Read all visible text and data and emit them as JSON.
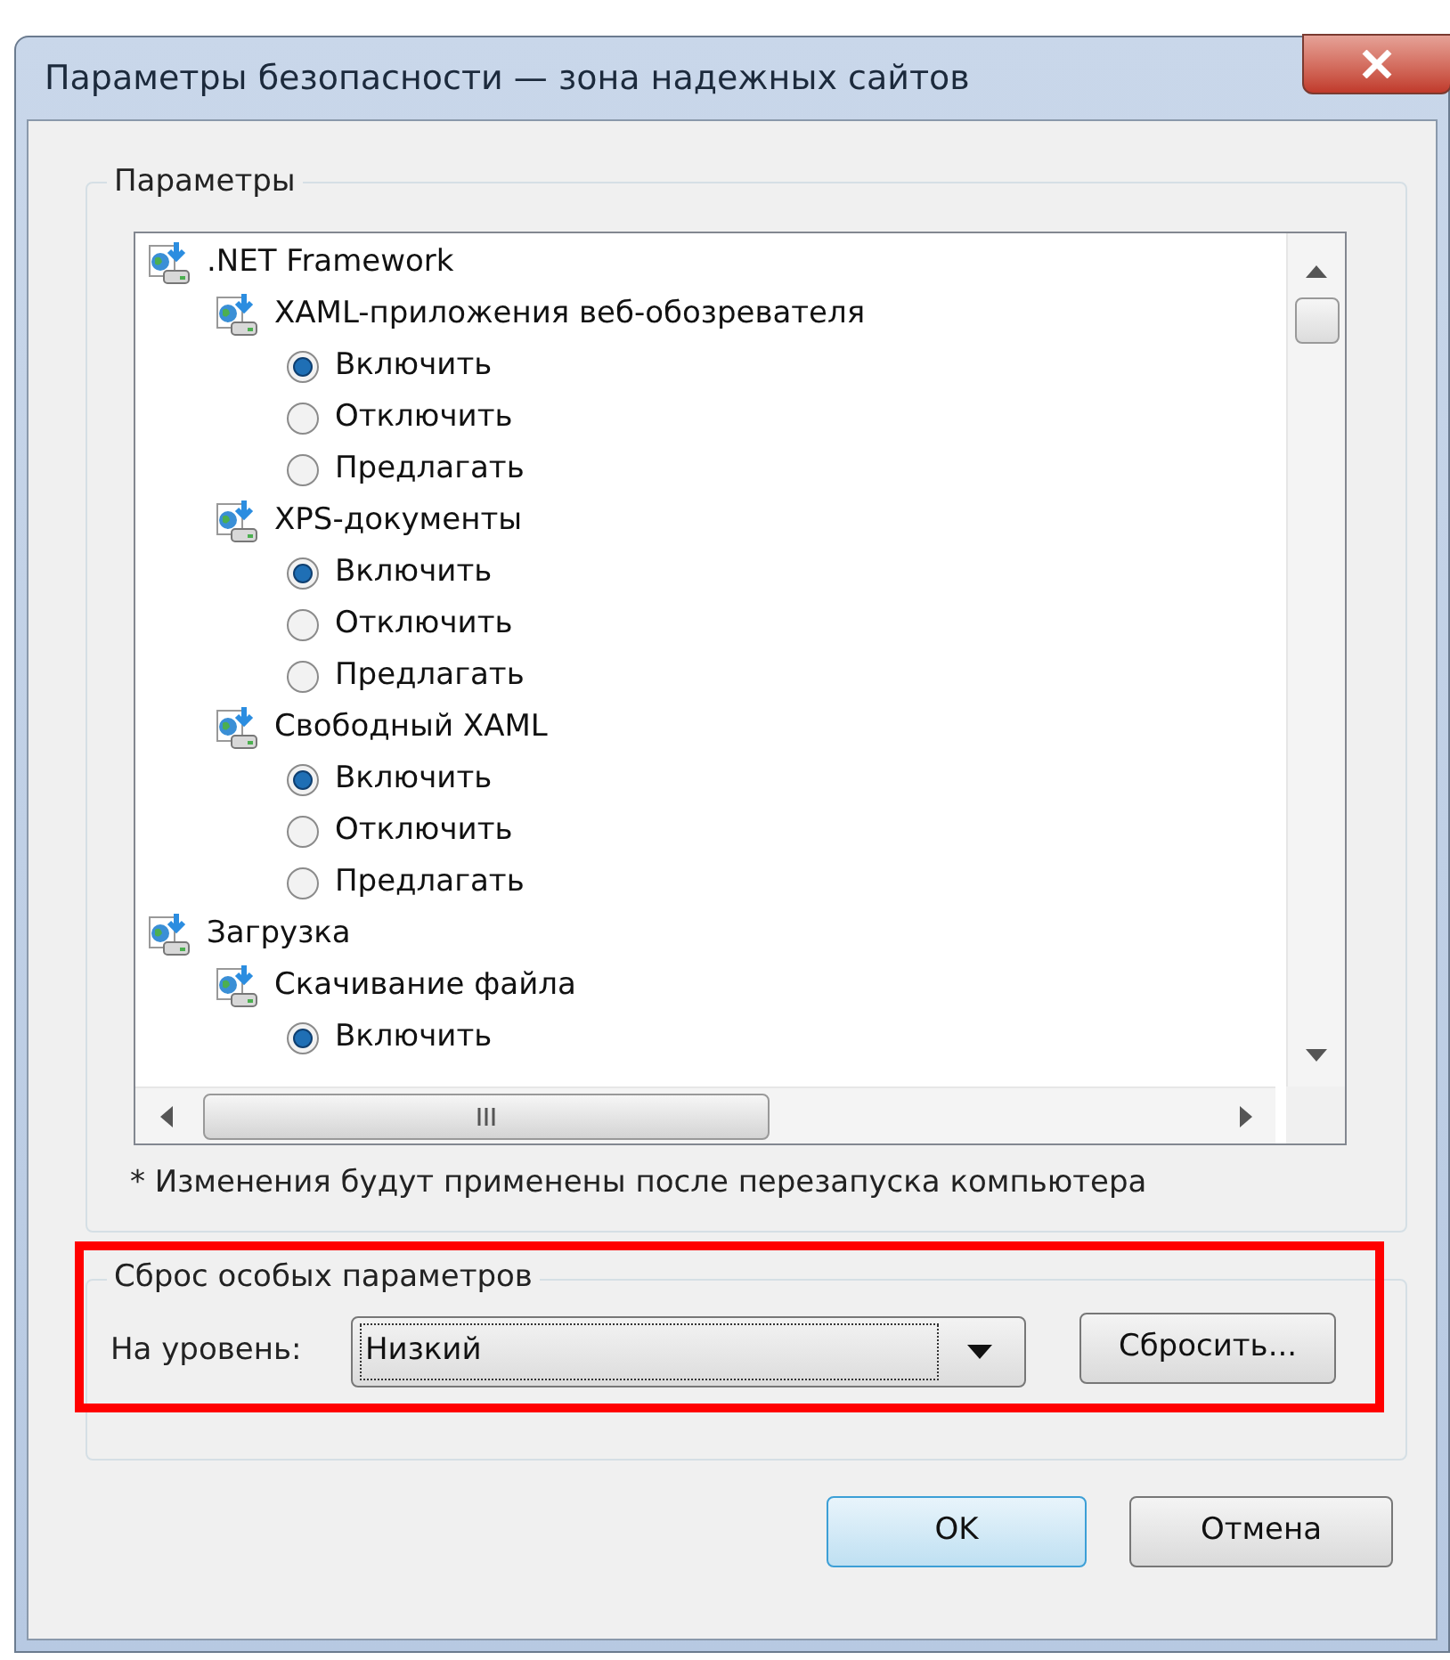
{
  "window": {
    "title": "Параметры безопасности — зона надежных сайтов"
  },
  "settings_group": {
    "title": "Параметры",
    "tree": [
      {
        "label": ".NET Framework",
        "children": [
          {
            "label": "XAML-приложения веб-обозревателя",
            "options": [
              {
                "label": "Включить",
                "selected": true
              },
              {
                "label": "Отключить",
                "selected": false
              },
              {
                "label": "Предлагать",
                "selected": false
              }
            ]
          },
          {
            "label": "XPS-документы",
            "options": [
              {
                "label": "Включить",
                "selected": true
              },
              {
                "label": "Отключить",
                "selected": false
              },
              {
                "label": "Предлагать",
                "selected": false
              }
            ]
          },
          {
            "label": "Свободный XAML",
            "options": [
              {
                "label": "Включить",
                "selected": true
              },
              {
                "label": "Отключить",
                "selected": false
              },
              {
                "label": "Предлагать",
                "selected": false
              }
            ]
          }
        ]
      },
      {
        "label": "Загрузка",
        "children": [
          {
            "label": "Скачивание файла",
            "options": [
              {
                "label": "Включить",
                "selected": true
              }
            ]
          }
        ]
      }
    ],
    "note": "* Изменения будут применены после перезапуска компьютера"
  },
  "reset_group": {
    "title": "Сброс особых параметров",
    "level_label": "На уровень:",
    "level_value": "Низкий",
    "reset_button": "Сбросить...",
    "highlighted": true
  },
  "buttons": [
    {
      "label": "OK",
      "default": true
    },
    {
      "label": "Отмена",
      "default": false
    }
  ]
}
